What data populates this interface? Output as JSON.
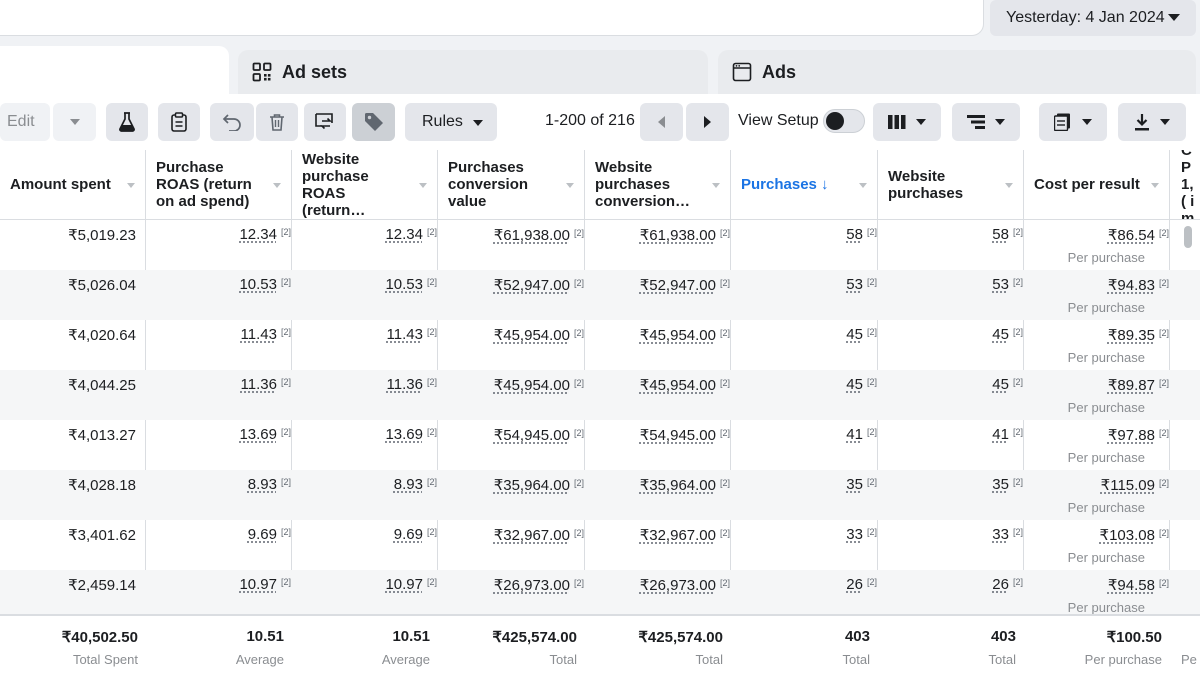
{
  "date_range": "Yesterday: 4 Jan 2024",
  "tabs": {
    "adsets": "Ad sets",
    "ads": "Ads"
  },
  "toolbar": {
    "edit": "Edit",
    "rules": "Rules",
    "pagination": "1-200 of 216",
    "view_setup": "View Setup"
  },
  "columns": [
    {
      "label": "Amount spent"
    },
    {
      "label": "Purchase ROAS (return on ad spend)"
    },
    {
      "label": "Website purchase ROAS (return…"
    },
    {
      "label": "Purchases conversion value"
    },
    {
      "label": "Website purchases conversion…"
    },
    {
      "label": "Purchases ↓"
    },
    {
      "label": "Website purchases"
    },
    {
      "label": "Cost per result"
    },
    {
      "label": "CP 1,( im"
    }
  ],
  "footnote_marker": "[2]",
  "cost_sublabel": "Per purchase",
  "rows": [
    {
      "spent": "₹5,019.23",
      "roas": "12.34",
      "web_roas": "12.34",
      "conv_value": "₹61,938.00",
      "web_conv_value": "₹61,938.00",
      "purchases": "58",
      "web_purchases": "58",
      "cost": "₹86.54"
    },
    {
      "spent": "₹5,026.04",
      "roas": "10.53",
      "web_roas": "10.53",
      "conv_value": "₹52,947.00",
      "web_conv_value": "₹52,947.00",
      "purchases": "53",
      "web_purchases": "53",
      "cost": "₹94.83"
    },
    {
      "spent": "₹4,020.64",
      "roas": "11.43",
      "web_roas": "11.43",
      "conv_value": "₹45,954.00",
      "web_conv_value": "₹45,954.00",
      "purchases": "45",
      "web_purchases": "45",
      "cost": "₹89.35"
    },
    {
      "spent": "₹4,044.25",
      "roas": "11.36",
      "web_roas": "11.36",
      "conv_value": "₹45,954.00",
      "web_conv_value": "₹45,954.00",
      "purchases": "45",
      "web_purchases": "45",
      "cost": "₹89.87"
    },
    {
      "spent": "₹4,013.27",
      "roas": "13.69",
      "web_roas": "13.69",
      "conv_value": "₹54,945.00",
      "web_conv_value": "₹54,945.00",
      "purchases": "41",
      "web_purchases": "41",
      "cost": "₹97.88"
    },
    {
      "spent": "₹4,028.18",
      "roas": "8.93",
      "web_roas": "8.93",
      "conv_value": "₹35,964.00",
      "web_conv_value": "₹35,964.00",
      "purchases": "35",
      "web_purchases": "35",
      "cost": "₹115.09"
    },
    {
      "spent": "₹3,401.62",
      "roas": "9.69",
      "web_roas": "9.69",
      "conv_value": "₹32,967.00",
      "web_conv_value": "₹32,967.00",
      "purchases": "33",
      "web_purchases": "33",
      "cost": "₹103.08"
    },
    {
      "spent": "₹2,459.14",
      "roas": "10.97",
      "web_roas": "10.97",
      "conv_value": "₹26,973.00",
      "web_conv_value": "₹26,973.00",
      "purchases": "26",
      "web_purchases": "26",
      "cost": "₹94.58"
    }
  ],
  "totals": {
    "spent": {
      "value": "₹40,502.50",
      "label": "Total Spent"
    },
    "roas": {
      "value": "10.51",
      "label": "Average"
    },
    "web_roas": {
      "value": "10.51",
      "label": "Average"
    },
    "conv_value": {
      "value": "₹425,574.00",
      "label": "Total"
    },
    "web_conv_value": {
      "value": "₹425,574.00",
      "label": "Total"
    },
    "purchases": {
      "value": "403",
      "label": "Total"
    },
    "web_purchases": {
      "value": "403",
      "label": "Total"
    },
    "cost": {
      "value": "₹100.50",
      "label": "Per purchase"
    },
    "cpm_label": "Pe"
  },
  "colors": {
    "accent": "#1b74e4",
    "border": "#dadde1",
    "muted": "#8a8d91"
  }
}
